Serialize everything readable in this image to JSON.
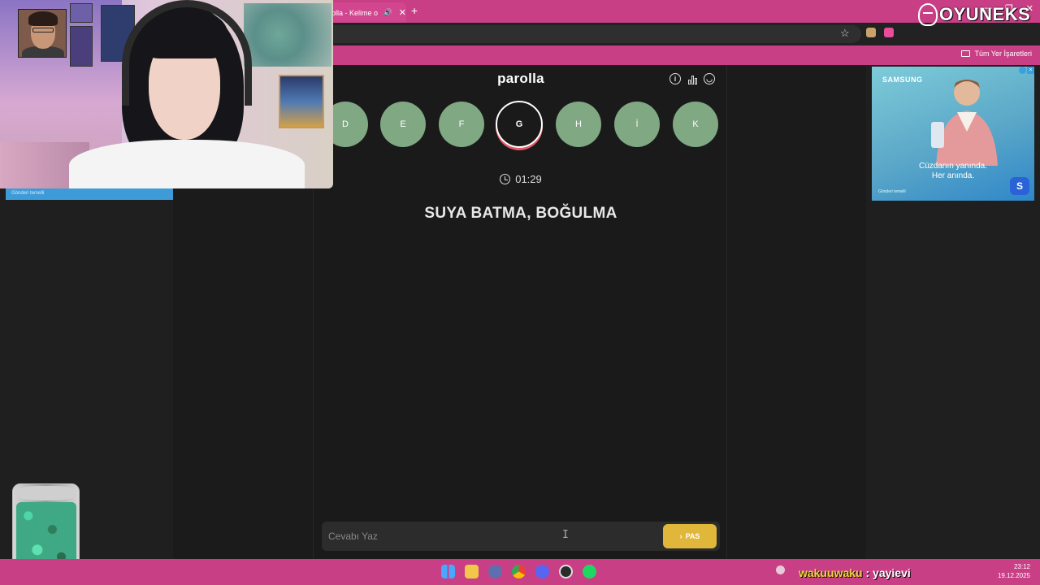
{
  "browser": {
    "tab_title": "olla - Kelime o",
    "tab_audio_icon": "speaker-icon",
    "new_tab_label": "+",
    "bookmarks_all_label": "Tüm Yer İşaretleri"
  },
  "app": {
    "title": "parolla",
    "header_icons": [
      "info-icon",
      "stats-icon",
      "profile-icon"
    ],
    "letters": [
      {
        "label": "D",
        "state": "pending"
      },
      {
        "label": "E",
        "state": "pending"
      },
      {
        "label": "F",
        "state": "pending"
      },
      {
        "label": "G",
        "state": "active"
      },
      {
        "label": "H",
        "state": "pending"
      },
      {
        "label": "İ",
        "state": "pending"
      },
      {
        "label": "K",
        "state": "pending"
      }
    ],
    "timer": "01:29",
    "question": "SUYA BATMA, BOĞULMA",
    "answer_placeholder": "Cevabı Yaz",
    "pass_label": "PAS",
    "colors": {
      "letter_bg": "#7fa883",
      "active_ring": "#e35a6a",
      "pass_button": "#e0b73a"
    }
  },
  "ads": {
    "left_footer": "Gönderi temelli",
    "right_brand": "SAMSUNG",
    "right_text_line1": "Cüzdanın yanında.",
    "right_text_line2": "Her anında.",
    "right_footer": "Gönderi temelli",
    "right_logo": "S"
  },
  "overlay": {
    "logo_text": "OYUNEKS",
    "stream_name_1": "wakuuwaku",
    "stream_sep": " : ",
    "stream_name_2": "yayievi"
  },
  "taskbar": {
    "time": "23:12",
    "date": "19.12.2025"
  }
}
